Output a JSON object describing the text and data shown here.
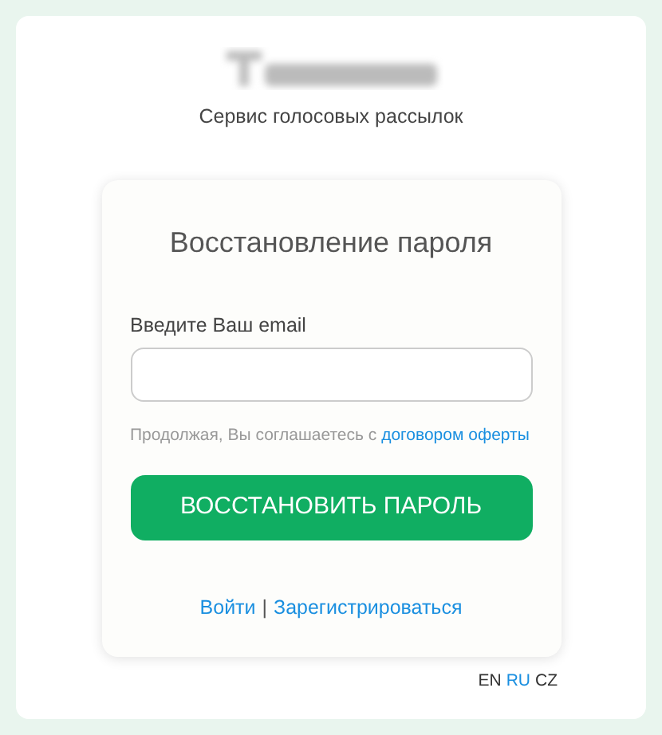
{
  "tagline": "Сервис голосовых рассылок",
  "card": {
    "title": "Восстановление пароля",
    "email_label": "Введите Ваш email",
    "consent_text": "Продолжая, Вы соглашаетесь с",
    "consent_link": "договором оферты",
    "submit": "ВОССТАНОВИТЬ ПАРОЛЬ"
  },
  "links": [
    {
      "kind": "link",
      "text": "Войти"
    },
    {
      "kind": "separator",
      "text": "|"
    },
    {
      "kind": "link",
      "text": "Зарегистрироваться"
    }
  ],
  "languages": [
    {
      "code": "EN",
      "selected": false
    },
    {
      "code": "RU",
      "selected": true
    },
    {
      "code": "CZ",
      "selected": false
    }
  ]
}
